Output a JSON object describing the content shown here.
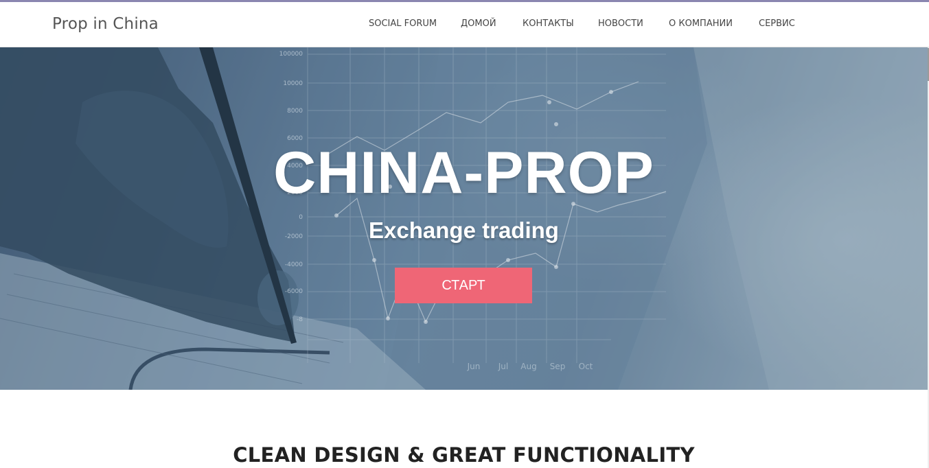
{
  "header": {
    "brand": "Prop in China",
    "nav": [
      {
        "label": "SOCIAL FORUM"
      },
      {
        "label": "ДОМОЙ"
      },
      {
        "label": "КОНТАКТЫ"
      },
      {
        "label": "НОВОСТИ"
      },
      {
        "label": "О КОМПАНИИ"
      },
      {
        "label": "СЕРВИС"
      }
    ]
  },
  "hero": {
    "title": "CHINA-PROP",
    "subtitle": "Exchange trading",
    "cta_label": "СТАРТ",
    "background_chart": {
      "y_ticks": [
        "100000",
        "10000",
        "8000",
        "6000",
        "4000",
        "2000",
        "0",
        "-2000",
        "-4000",
        "-6000",
        "-8"
      ],
      "x_ticks": [
        "Jun",
        "Jul",
        "Aug",
        "Sep",
        "Oct"
      ]
    }
  },
  "section": {
    "title": "CLEAN DESIGN & GREAT FUNCTIONALITY"
  },
  "colors": {
    "accent_bar": "#8a86b0",
    "cta": "#ef6676",
    "hero_overlay": "#5d7893"
  }
}
